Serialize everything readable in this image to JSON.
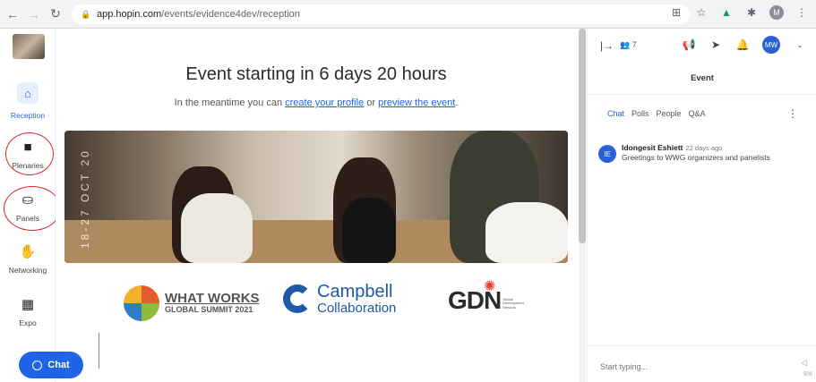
{
  "browser": {
    "url_host": "app.hopin.com",
    "url_path": "/events/evidence4dev/reception",
    "profile_initial": "M"
  },
  "leftnav": {
    "items": [
      {
        "label": "Reception"
      },
      {
        "label": "Plenaries"
      },
      {
        "label": "Panels"
      },
      {
        "label": "Networking"
      },
      {
        "label": "Expo"
      }
    ],
    "chat_button": "Chat"
  },
  "main": {
    "title": "Event starting in 6 days 20 hours",
    "sub_prefix": "In the meantime you can",
    "sub_link1": "create your profile",
    "sub_mid": "or",
    "sub_link2": "preview the event",
    "sub_end": ".",
    "banner_date": "18-27 OCT 20",
    "logo_wwg_title": "WHAT WORKS",
    "logo_wwg_sub": "GLOBAL SUMMIT 2021",
    "logo_campbell_1": "Campbell",
    "logo_campbell_2": "Collaboration",
    "logo_gdn": "GDN",
    "logo_gdn_sub": "Global Development Network"
  },
  "right_panel": {
    "people_count": "7",
    "avatar_initials": "MW",
    "title": "Event",
    "tabs": [
      "Chat",
      "Polls",
      "People",
      "Q&A"
    ],
    "message": {
      "avatar": "IE",
      "name": "Idongesit Eshiett",
      "time": "22 days ago",
      "text": "Greetings to WWG organizers and panelists"
    },
    "input_placeholder": "Start typing...",
    "char_count": "500"
  }
}
